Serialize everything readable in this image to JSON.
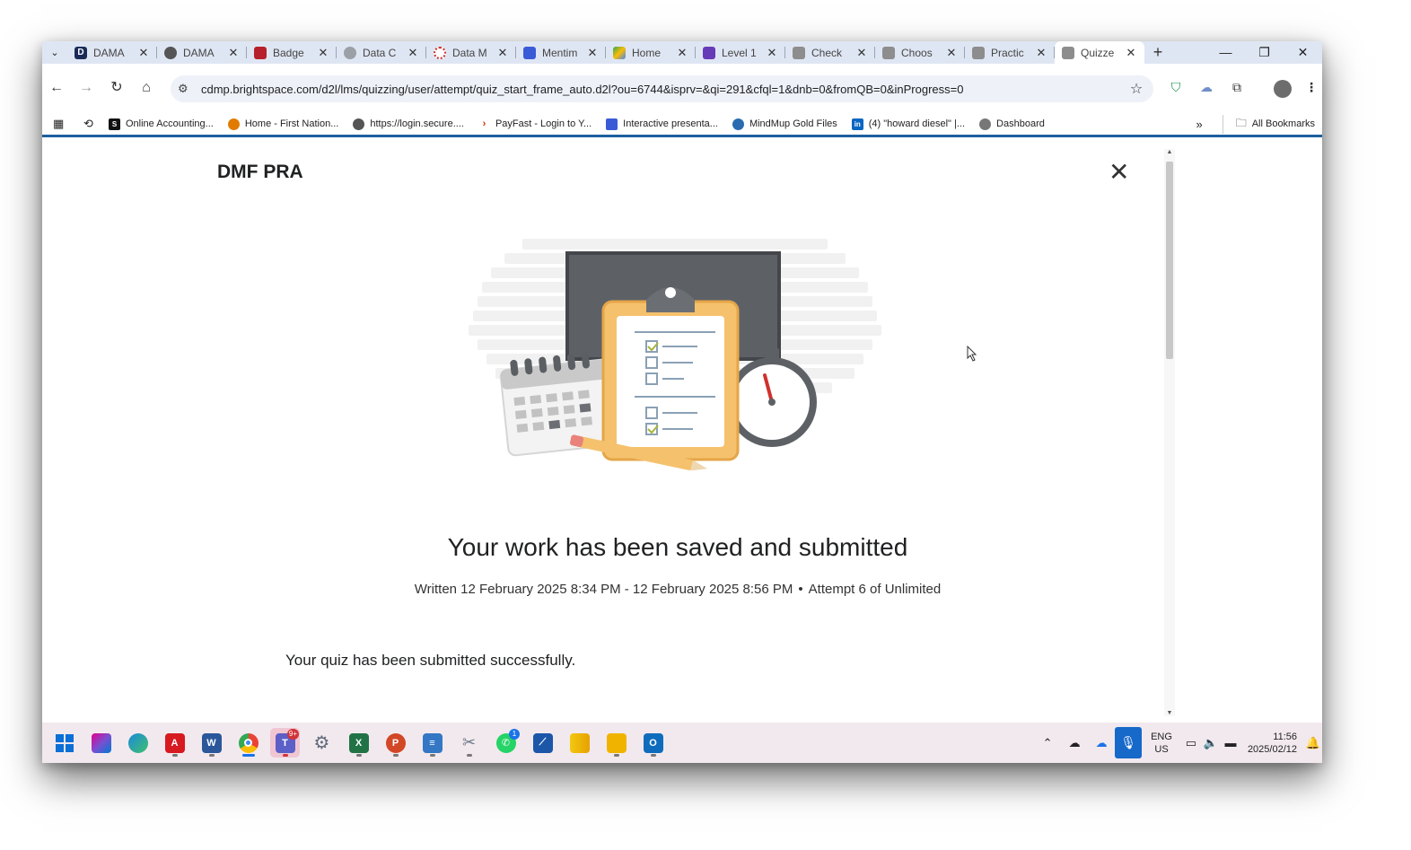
{
  "tabs": [
    {
      "label": "DAMA",
      "icon": "dama-d-icon"
    },
    {
      "label": "DAMA",
      "icon": "globe-icon"
    },
    {
      "label": "Badge",
      "icon": "badge-icon"
    },
    {
      "label": "Data C",
      "icon": "data-icon"
    },
    {
      "label": "Data M",
      "icon": "data-m-icon"
    },
    {
      "label": "Mentim",
      "icon": "mentimeter-icon"
    },
    {
      "label": "Home",
      "icon": "google-drive-icon"
    },
    {
      "label": "Level 1",
      "icon": "forms-icon"
    },
    {
      "label": "Check",
      "icon": "d2l-icon"
    },
    {
      "label": "Choos",
      "icon": "d2l-icon"
    },
    {
      "label": "Practic",
      "icon": "d2l-icon"
    },
    {
      "label": "Quizze",
      "icon": "d2l-icon",
      "active": true
    }
  ],
  "toolbar": {
    "url": "cdmp.brightspace.com/d2l/lms/quizzing/user/attempt/quiz_start_frame_auto.d2l?ou=6744&isprv=&qi=291&cfql=1&dnb=0&fromQB=0&inProgress=0"
  },
  "bookmarks": [
    {
      "label": "Online Accounting...",
      "color": "#111111"
    },
    {
      "label": "Home - First Nation...",
      "color": "#e07b00"
    },
    {
      "label": "https://login.secure....",
      "color": "#555555"
    },
    {
      "label": "PayFast - Login to Y...",
      "color": "#d03000"
    },
    {
      "label": "Interactive presenta...",
      "color": "#3a5bd8"
    },
    {
      "label": "MindMup Gold Files",
      "color": "#2b6cb0"
    },
    {
      "label": "(4) \"howard diesel\" |...",
      "color": "#0a66c2"
    },
    {
      "label": "Dashboard",
      "color": "#777777"
    }
  ],
  "bookmarks_all": "All Bookmarks",
  "page": {
    "quiz_title": "DMF PRA",
    "headline": "Your work has been saved and submitted",
    "written": "Written 12 February 2025 8:34 PM - 12 February 2025 8:56 PM",
    "separator": "•",
    "attempt": "Attempt 6 of Unlimited",
    "message": "Your quiz has been submitted successfully."
  },
  "taskbar": {
    "apps": [
      {
        "name": "start",
        "color": "#0a6fd6"
      },
      {
        "name": "microsoft-365",
        "color": "#7a4fd1"
      },
      {
        "name": "edge",
        "color": "#1b8adb"
      },
      {
        "name": "acrobat",
        "color": "#d71920"
      },
      {
        "name": "word",
        "color": "#2b579a"
      },
      {
        "name": "chrome",
        "color": "#34a853"
      },
      {
        "name": "teams",
        "color": "#5b5fc7",
        "badge": "9+"
      },
      {
        "name": "settings",
        "color": "#5f6b7a"
      },
      {
        "name": "excel",
        "color": "#217346"
      },
      {
        "name": "powerpoint",
        "color": "#d24726"
      },
      {
        "name": "notepad",
        "color": "#3477c4"
      },
      {
        "name": "snipping",
        "color": "#6c7a89"
      },
      {
        "name": "whatsapp",
        "color": "#25d366",
        "badge": "1"
      },
      {
        "name": "pdf-viewer",
        "color": "#1c56a8"
      },
      {
        "name": "power-bi",
        "color": "#f2c811"
      },
      {
        "name": "file-explorer",
        "color": "#f0b400"
      },
      {
        "name": "outlook",
        "color": "#0f6cbd"
      }
    ],
    "lang_1": "ENG",
    "lang_2": "US",
    "time": "11:56",
    "date": "2025/02/12"
  }
}
